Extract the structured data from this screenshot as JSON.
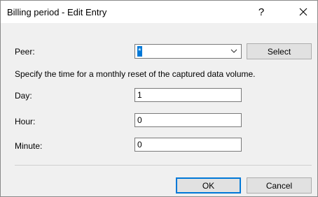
{
  "window": {
    "title": "Billing period - Edit Entry",
    "help_label": "?",
    "close_icon": "close-icon"
  },
  "form": {
    "peer_label": "Peer:",
    "peer_value": "*",
    "select_button": "Select",
    "description": "Specify the time for a monthly reset of the captured data volume.",
    "day_label": "Day:",
    "day_value": "1",
    "hour_label": "Hour:",
    "hour_value": "0",
    "minute_label": "Minute:",
    "minute_value": "0"
  },
  "buttons": {
    "ok": "OK",
    "cancel": "Cancel"
  },
  "colors": {
    "selection": "#0078d7",
    "dialog_bg": "#f0f0f0"
  }
}
